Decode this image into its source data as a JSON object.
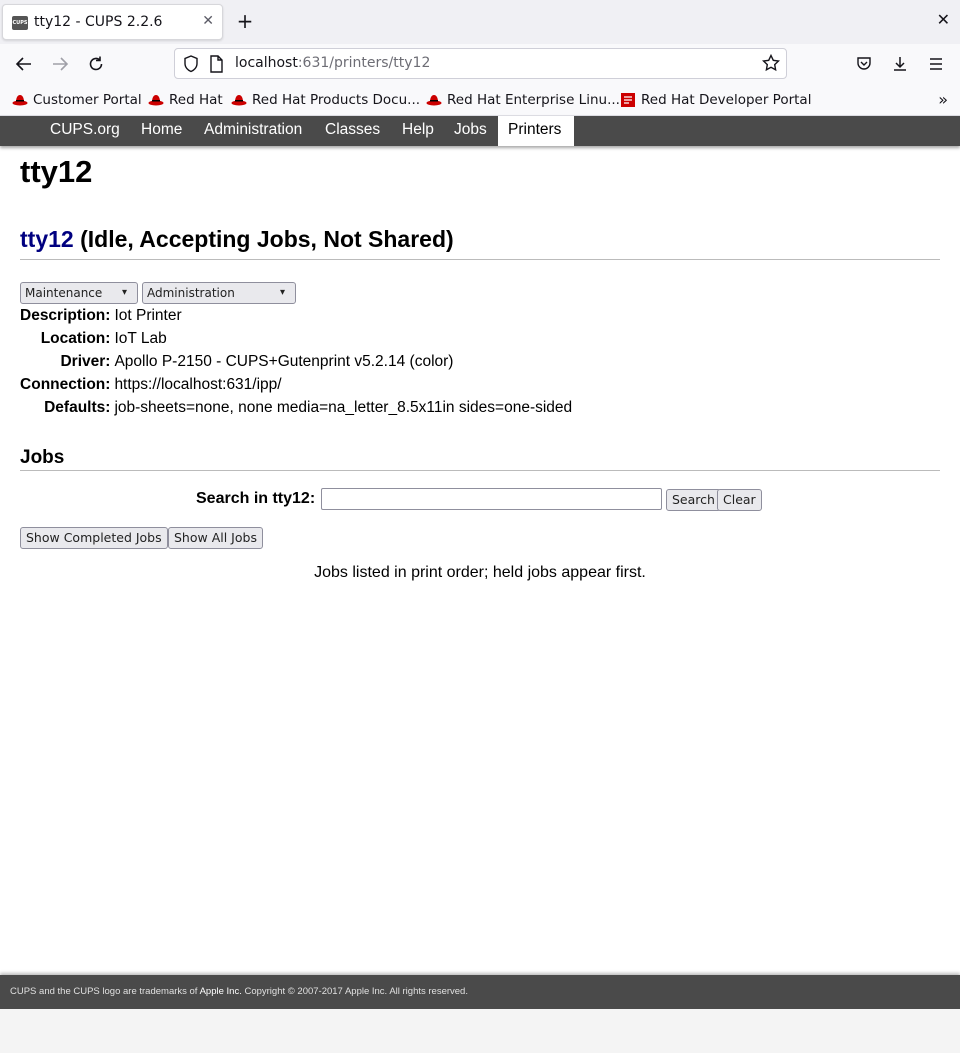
{
  "browser": {
    "tab": {
      "title": "tty12 - CUPS 2.2.6",
      "favicon_text": "CUPS"
    },
    "url": {
      "host": "localhost",
      "rest": ":631/printers/tty12"
    },
    "bookmarks": [
      {
        "label": "Customer Portal",
        "icon": "redhat-icon"
      },
      {
        "label": "Red Hat",
        "icon": "redhat-icon"
      },
      {
        "label": "Red Hat Products Docu...",
        "icon": "redhat-icon"
      },
      {
        "label": "Red Hat Enterprise Linu...",
        "icon": "redhat-icon"
      },
      {
        "label": "Red Hat Developer Portal",
        "icon": "developer-portal-icon"
      }
    ],
    "colors": {
      "tabbar": "#f0f0f4",
      "toolbar": "#f9f9fb"
    }
  },
  "cups_nav": {
    "items": [
      {
        "label": "CUPS.org"
      },
      {
        "label": "Home"
      },
      {
        "label": "Administration"
      },
      {
        "label": "Classes"
      },
      {
        "label": "Help"
      },
      {
        "label": "Jobs"
      },
      {
        "label": "Printers",
        "active": true
      }
    ],
    "color": "#4a4a4a"
  },
  "page": {
    "title": "tty12",
    "printer_link": "tty12",
    "printer_status": "(Idle, Accepting Jobs, Not Shared)",
    "maintenance_select": "Maintenance",
    "administration_select": "Administration",
    "properties": [
      {
        "label": "Description:",
        "value": "Iot Printer"
      },
      {
        "label": "Location:",
        "value": "IoT Lab"
      },
      {
        "label": "Driver:",
        "value": "Apollo P-2150 - CUPS+Gutenprint v5.2.14 (color)"
      },
      {
        "label": "Connection:",
        "value": "https://localhost:631/ipp/"
      },
      {
        "label": "Defaults:",
        "value": "job-sheets=none, none media=na_letter_8.5x11in sides=one-sided"
      }
    ],
    "jobs_heading": "Jobs",
    "search_label": "Search in tty12:",
    "search_value": "",
    "search_button": "Search",
    "clear_button": "Clear",
    "show_completed_button": "Show Completed Jobs",
    "show_all_button": "Show All Jobs",
    "jobs_note": "Jobs listed in print order; held jobs appear first.",
    "link_color": "#000080"
  },
  "footer": {
    "prefix": "CUPS and the CUPS logo are trademarks of ",
    "apple_link": "Apple Inc.",
    "suffix": " Copyright © 2007-2017 Apple Inc. All rights reserved."
  }
}
